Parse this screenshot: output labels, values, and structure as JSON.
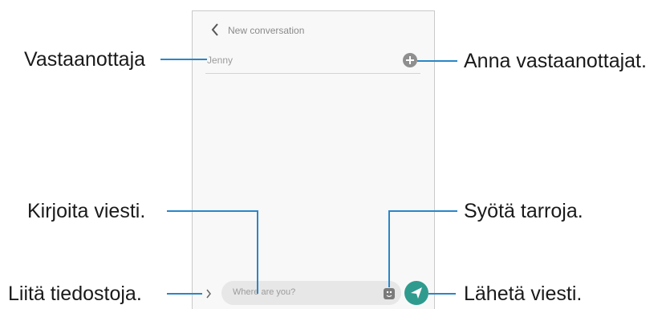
{
  "callouts": {
    "recipient": "Vastaanottaja",
    "add_recipients": "Anna vastaanottajat.",
    "write_message": "Kirjoita viesti.",
    "insert_stickers": "Syötä tarroja.",
    "attach_files": "Liitä tiedostoja.",
    "send_message": "Lähetä viesti."
  },
  "screen": {
    "title": "New conversation",
    "recipient_value": "Jenny",
    "message_placeholder": "Where are you?"
  },
  "icons": {
    "back": "back-chevron-icon",
    "add": "add-circle-icon",
    "expand": "chevron-right-icon",
    "sticker": "sticker-icon",
    "send": "send-icon"
  },
  "colors": {
    "callout_line": "#2a86c8",
    "send_button": "#2f9b8f"
  }
}
